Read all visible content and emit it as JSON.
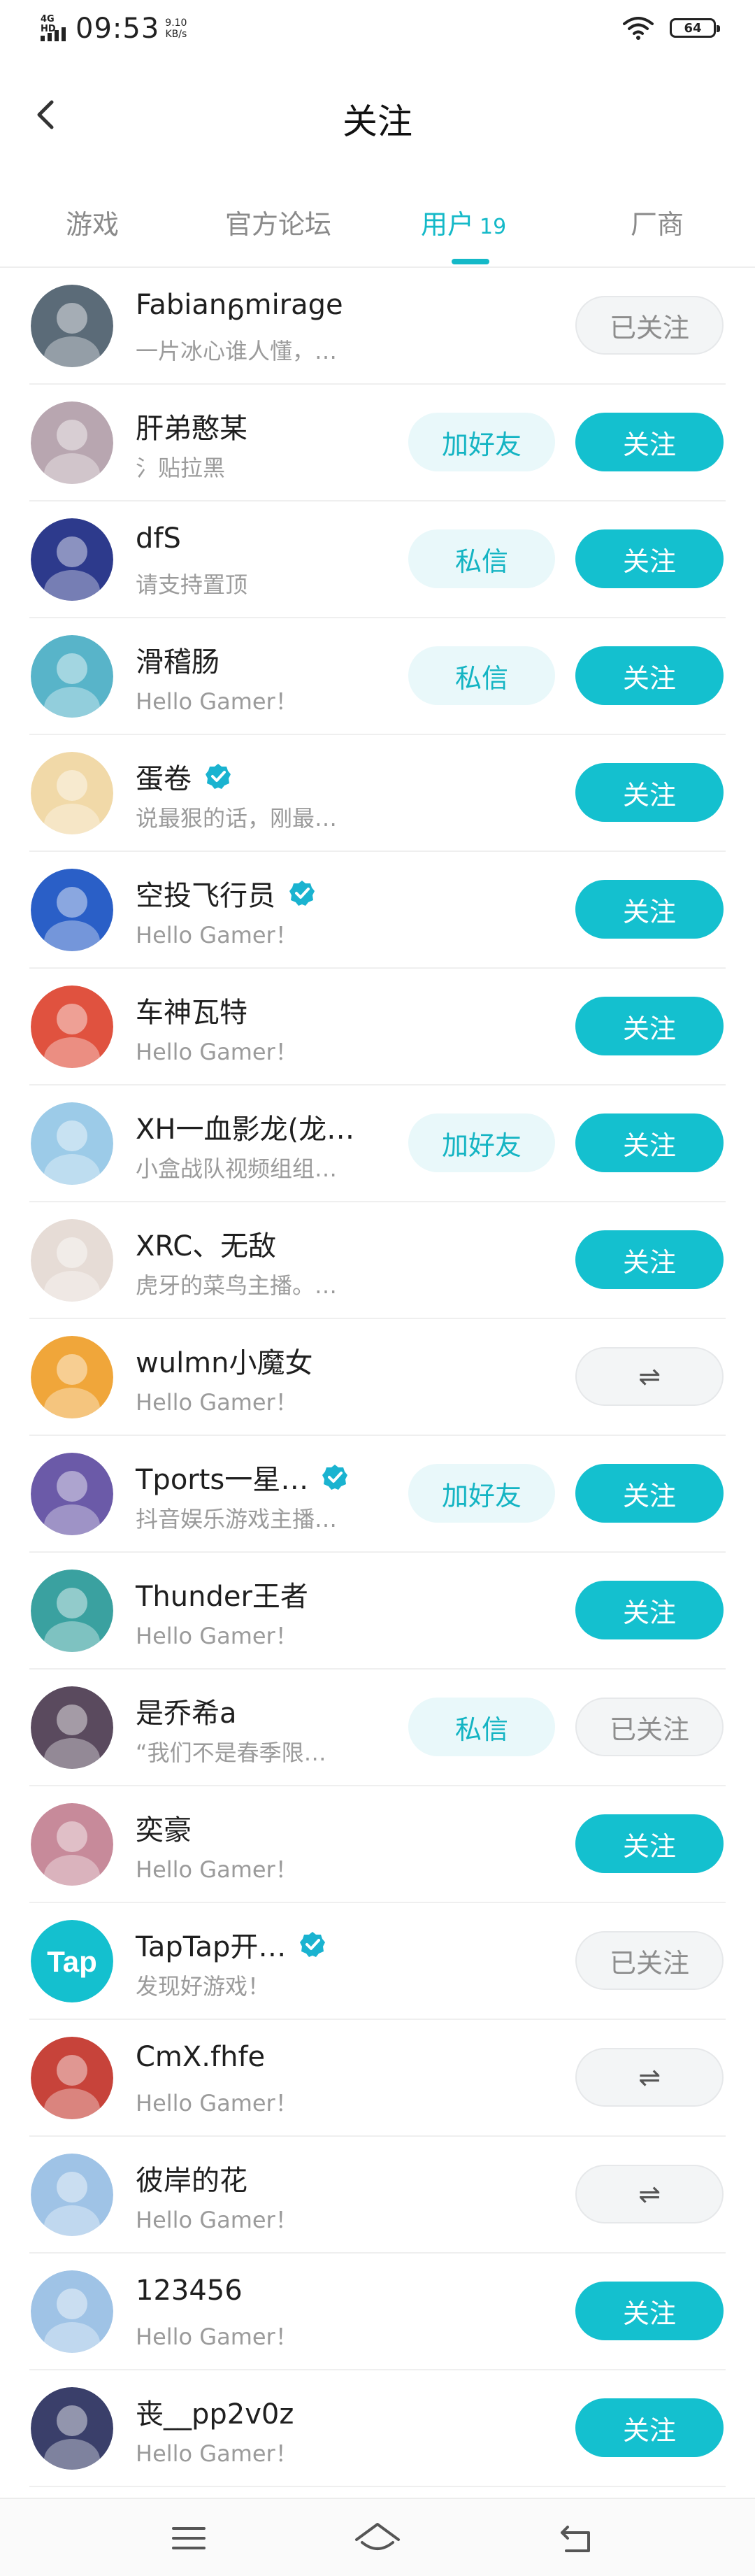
{
  "status_bar": {
    "network": "4G HD",
    "time": "09:53",
    "speed_value": "9.10",
    "speed_unit": "KB/s",
    "battery": "64"
  },
  "header": {
    "title": "关注",
    "back_icon": "chevron-left-icon"
  },
  "tabs": [
    {
      "label": "游戏",
      "count": ""
    },
    {
      "label": "官方论坛",
      "count": ""
    },
    {
      "label": "用户",
      "count": "19"
    },
    {
      "label": "厂商",
      "count": ""
    }
  ],
  "colors": {
    "accent": "#14c0cf",
    "text": "#1f1f1f",
    "muted": "#9b9b9b",
    "verified": "#1ab3d0"
  },
  "users": [
    {
      "name": "Fabianᵷmirage",
      "desc": "一片冰心谁人懂，…",
      "verified": false,
      "secondary": "",
      "primary": "已关注",
      "primary_style": "followed",
      "avatar_color": "#5b6b78"
    },
    {
      "name": "肝弟憨某",
      "desc": "氵贴拉黑",
      "verified": false,
      "secondary": "加好友",
      "primary": "关注",
      "primary_style": "follow",
      "avatar_color": "#b8a6b0"
    },
    {
      "name": "dfS",
      "desc": "请支持置顶",
      "verified": false,
      "secondary": "私信",
      "primary": "关注",
      "primary_style": "follow",
      "avatar_color": "#2d3a8c"
    },
    {
      "name": "滑稽肠",
      "desc": "Hello Gamer！",
      "verified": false,
      "secondary": "私信",
      "primary": "关注",
      "primary_style": "follow",
      "avatar_color": "#58b4c9"
    },
    {
      "name": "蛋卷",
      "desc": "说最狠的话，刚最…",
      "verified": true,
      "secondary": "",
      "primary": "关注",
      "primary_style": "follow",
      "avatar_color": "#f1d9a8"
    },
    {
      "name": "空投飞行员",
      "desc": "Hello Gamer！",
      "verified": true,
      "secondary": "",
      "primary": "关注",
      "primary_style": "follow",
      "avatar_color": "#2a5fc7"
    },
    {
      "name": "车神瓦特",
      "desc": "Hello Gamer！",
      "verified": false,
      "secondary": "",
      "primary": "关注",
      "primary_style": "follow",
      "avatar_color": "#e0523f"
    },
    {
      "name": "XH一血影龙(龙…",
      "desc": "小盒战队视频组组…",
      "verified": false,
      "secondary": "加好友",
      "primary": "关注",
      "primary_style": "follow",
      "avatar_color": "#9ccbe8"
    },
    {
      "name": "XRC、无敌",
      "desc": "虎牙的菜鸟主播。…",
      "verified": false,
      "secondary": "",
      "primary": "关注",
      "primary_style": "follow",
      "avatar_color": "#e6dcd6"
    },
    {
      "name": "wulmn小魔女",
      "desc": "Hello Gamer！",
      "verified": false,
      "secondary": "",
      "primary": "⇌",
      "primary_style": "mutual",
      "avatar_color": "#f0a63a"
    },
    {
      "name": "Tports一星…",
      "desc": "抖音娱乐游戏主播…",
      "verified": true,
      "secondary": "加好友",
      "primary": "关注",
      "primary_style": "follow",
      "avatar_color": "#6b5aa8"
    },
    {
      "name": "Thunder王者",
      "desc": "Hello Gamer！",
      "verified": false,
      "secondary": "",
      "primary": "关注",
      "primary_style": "follow",
      "avatar_color": "#3aa1a0"
    },
    {
      "name": "是乔希a",
      "desc": "“我们不是春季限…",
      "verified": false,
      "secondary": "私信",
      "primary": "已关注",
      "primary_style": "followed",
      "avatar_color": "#5a4a5e"
    },
    {
      "name": "奕豪",
      "desc": "Hello Gamer！",
      "verified": false,
      "secondary": "",
      "primary": "关注",
      "primary_style": "follow",
      "avatar_color": "#c78a9a"
    },
    {
      "name": "TapTap开…",
      "desc": "发现好游戏！",
      "verified": true,
      "secondary": "",
      "primary": "已关注",
      "primary_style": "followed",
      "avatar_color": "#14c0cf",
      "avatar_text": "Tap"
    },
    {
      "name": "CmX.fhfe",
      "desc": "Hello Gamer！",
      "verified": false,
      "secondary": "",
      "primary": "⇌",
      "primary_style": "mutual",
      "avatar_color": "#c7433a"
    },
    {
      "name": "彼岸的花",
      "desc": "Hello Gamer！",
      "verified": false,
      "secondary": "",
      "primary": "⇌",
      "primary_style": "mutual",
      "avatar_color": "#9fc3e6"
    },
    {
      "name": "123456",
      "desc": "Hello Gamer！",
      "verified": false,
      "secondary": "",
      "primary": "关注",
      "primary_style": "follow",
      "avatar_color": "#9fc3e6"
    },
    {
      "name": "丧__pp2v0z",
      "desc": "Hello Gamer！",
      "verified": false,
      "secondary": "",
      "primary": "关注",
      "primary_style": "follow",
      "avatar_color": "#3a3f6a"
    }
  ],
  "nav_bar": {
    "icons": [
      "menu-icon",
      "home-icon",
      "back-icon"
    ]
  }
}
